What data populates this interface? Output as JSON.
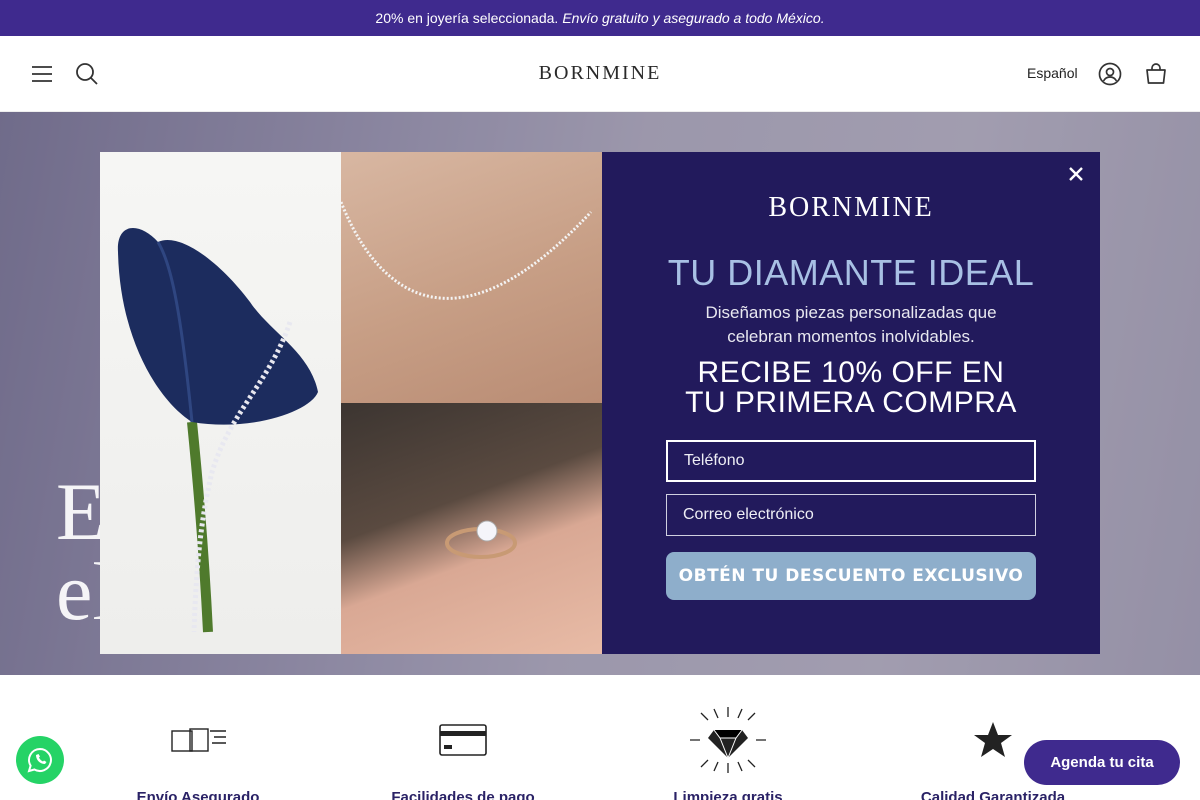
{
  "announcement": {
    "main": "20% en joyería seleccionada.",
    "italic": "Envío gratuito y asegurado a todo México."
  },
  "header": {
    "logo": "BORNMINE",
    "language": "Español",
    "icons": [
      "menu-icon",
      "search-icon",
      "account-icon",
      "cart-icon"
    ]
  },
  "hero": {
    "headline_line1": "El anillo",
    "headline_line2": "ella ma"
  },
  "popup": {
    "logo": "BORNMINE",
    "title": "TU DIAMANTE IDEAL",
    "description": "Diseñamos piezas personalizadas que celebran momentos inolvidables.",
    "offer_line1": "RECIBE 10% OFF EN",
    "offer_line2": "TU PRIMERA COMPRA",
    "phone_placeholder": "Teléfono",
    "email_placeholder": "Correo electrónico",
    "cta": "OBTÉN TU DESCUENTO EXCLUSIVO",
    "colors": {
      "panel": "#221a5c",
      "title": "#a8c0e4",
      "button": "#8eaecb"
    }
  },
  "features": [
    {
      "icon": "shipping-box-icon",
      "label": "Envío Asegurado"
    },
    {
      "icon": "credit-card-icon",
      "label": "Facilidades de pago"
    },
    {
      "icon": "diamond-icon",
      "label": "Limpieza gratis"
    },
    {
      "icon": "star-icon",
      "label": "Calidad Garantizada"
    }
  ],
  "floating": {
    "whatsapp_icon": "whatsapp-icon",
    "appointment_label": "Agenda tu cita"
  },
  "colors": {
    "brand": "#3f2a8e",
    "whatsapp": "#25d366"
  }
}
